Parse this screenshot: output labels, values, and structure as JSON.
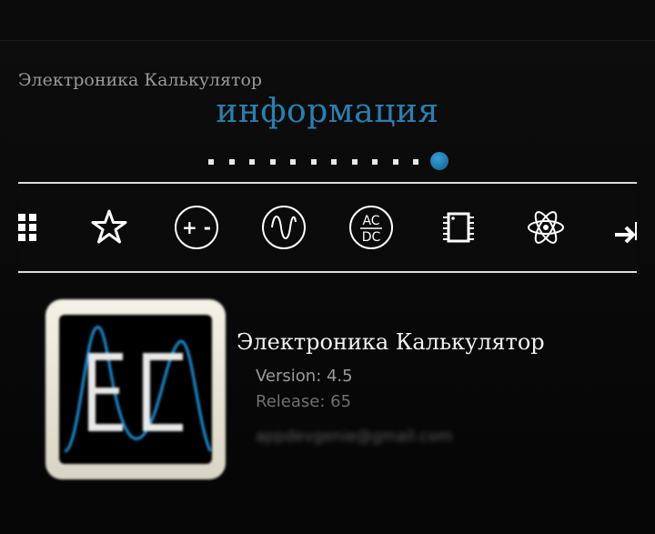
{
  "header": {
    "app_title": "Электроника Калькулятор",
    "page_title": "информация"
  },
  "pager": {
    "count": 12,
    "active_index": 11,
    "accent_color": "#2a8fc8"
  },
  "toolbar": {
    "buttons": [
      {
        "name": "grid-icon",
        "label": ""
      },
      {
        "name": "star-icon",
        "label": ""
      },
      {
        "name": "plus-minus-icon",
        "label": "+ -"
      },
      {
        "name": "sine-wave-icon",
        "label": ""
      },
      {
        "name": "ac-dc-icon",
        "label_top": "AC",
        "label_bottom": "DC"
      },
      {
        "name": "chip-icon",
        "label": ""
      },
      {
        "name": "atom-icon",
        "label": ""
      },
      {
        "name": "arrow-right-icon",
        "label": ""
      }
    ]
  },
  "about": {
    "app_name": "Электроника Калькулятор",
    "version": "Version: 4.5",
    "release": "Release: 65",
    "email": "appdevgenie@gmail.com"
  },
  "colors": {
    "accent": "#2a7fb2",
    "background": "#000000",
    "divider": "#dcdcdc"
  }
}
